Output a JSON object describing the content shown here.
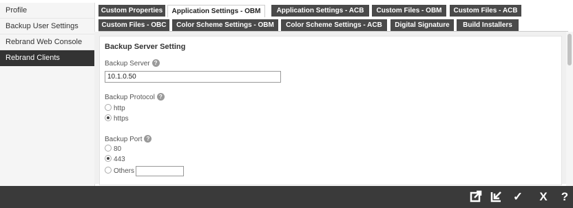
{
  "sidebar": {
    "items": [
      {
        "label": "Profile"
      },
      {
        "label": "Backup User Settings"
      },
      {
        "label": "Rebrand Web Console"
      },
      {
        "label": "Rebrand Clients",
        "active": true
      }
    ]
  },
  "tabs": {
    "row1": [
      {
        "label": "Custom Properties"
      },
      {
        "label": "Application Settings - OBM",
        "active": true
      },
      {
        "label": "Application Settings - ACB"
      },
      {
        "label": "Custom Files - OBM"
      },
      {
        "label": "Custom Files - ACB"
      }
    ],
    "row2": [
      {
        "label": "Custom Files - OBC"
      },
      {
        "label": "Color Scheme Settings - OBM"
      },
      {
        "label": "Color Scheme Settings - ACB"
      },
      {
        "label": "Digital Signature"
      },
      {
        "label": "Build Installers"
      }
    ]
  },
  "section": {
    "title": "Backup Server Setting"
  },
  "backup_server": {
    "label": "Backup Server",
    "value": "10.1.0.50"
  },
  "backup_protocol": {
    "label": "Backup Protocol",
    "options": [
      {
        "label": "http",
        "checked": false
      },
      {
        "label": "https",
        "checked": true
      }
    ]
  },
  "backup_port": {
    "label": "Backup Port",
    "options": [
      {
        "label": "80",
        "checked": false
      },
      {
        "label": "443",
        "checked": true
      },
      {
        "label": "Others",
        "checked": false
      }
    ],
    "others_value": ""
  },
  "help_glyph": "?",
  "footer": {
    "buttons": [
      {
        "name": "export-icon",
        "glyph": "⇗"
      },
      {
        "name": "import-icon",
        "glyph": "⇙"
      },
      {
        "name": "save-check-icon",
        "glyph": "✓"
      },
      {
        "name": "cancel-x-icon",
        "glyph": "X"
      },
      {
        "name": "help-icon",
        "glyph": "?"
      }
    ]
  }
}
